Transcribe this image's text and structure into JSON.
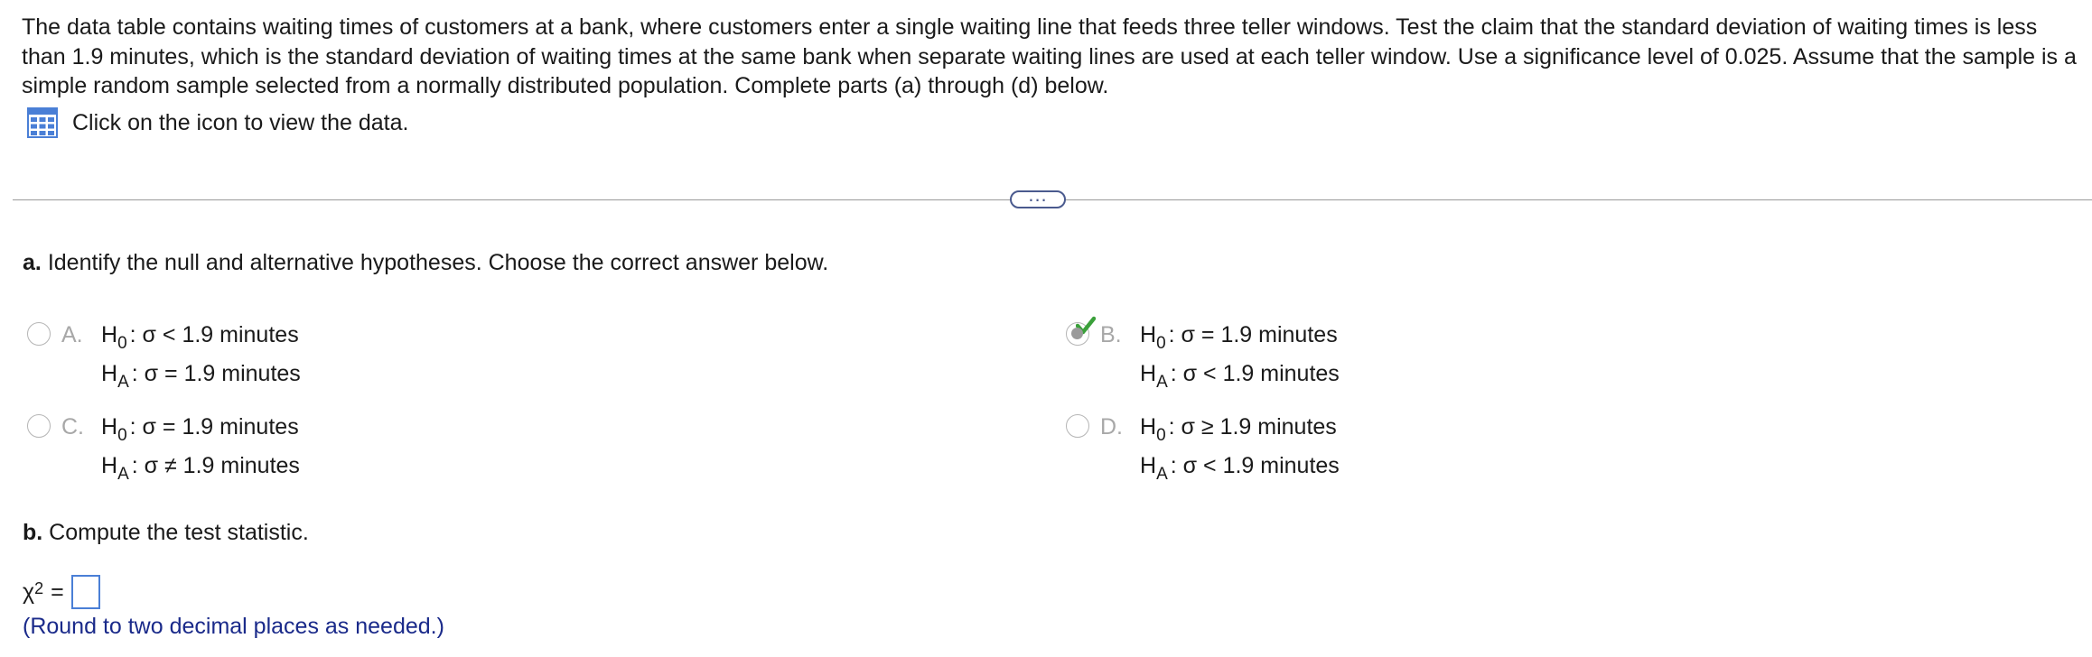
{
  "intro": {
    "text": "The data table contains waiting times of customers at a bank, where customers enter a single waiting line that feeds three teller windows. Test the claim that the standard deviation of waiting times is less than 1.9 minutes, which is the standard deviation of waiting times at the same bank when separate waiting lines are used at each teller window. Use a significance level of 0.025. Assume that the sample is a simple random sample selected from a normally distributed population. Complete parts (a) through (d) below.",
    "data_link": "Click on the icon to view the data."
  },
  "divider": {
    "more_label": "..."
  },
  "part_a": {
    "letter": "a.",
    "prompt": "Identify the null and alternative hypotheses. Choose the correct answer below.",
    "options": [
      {
        "letter": "A.",
        "h0_label": "H",
        "h0_sub": "0",
        "h0_text": ": σ < 1.9 minutes",
        "ha_label": "H",
        "ha_sub": "A",
        "ha_text": ": σ = 1.9 minutes",
        "selected": false
      },
      {
        "letter": "B.",
        "h0_label": "H",
        "h0_sub": "0",
        "h0_text": ": σ = 1.9 minutes",
        "ha_label": "H",
        "ha_sub": "A",
        "ha_text": ": σ < 1.9 minutes",
        "selected": true
      },
      {
        "letter": "C.",
        "h0_label": "H",
        "h0_sub": "0",
        "h0_text": ": σ = 1.9 minutes",
        "ha_label": "H",
        "ha_sub": "A",
        "ha_text": ": σ ≠ 1.9 minutes",
        "selected": false
      },
      {
        "letter": "D.",
        "h0_label": "H",
        "h0_sub": "0",
        "h0_text": ": σ ≥ 1.9 minutes",
        "ha_label": "H",
        "ha_sub": "A",
        "ha_text": ": σ < 1.9 minutes",
        "selected": false
      }
    ]
  },
  "part_b": {
    "letter": "b.",
    "prompt": "Compute the test statistic.",
    "symbol": "χ",
    "exponent": "2",
    "equals": "=",
    "answer_value": "",
    "note": "(Round to two decimal places as needed.)"
  },
  "colors": {
    "check": "#3aa03a",
    "note": "#1a2a8a",
    "icon": "#4a7fd6",
    "answer_border": "#4a7fd6"
  },
  "icons": {
    "data_table": "grid-table-icon",
    "correct": "checkmark-icon"
  }
}
